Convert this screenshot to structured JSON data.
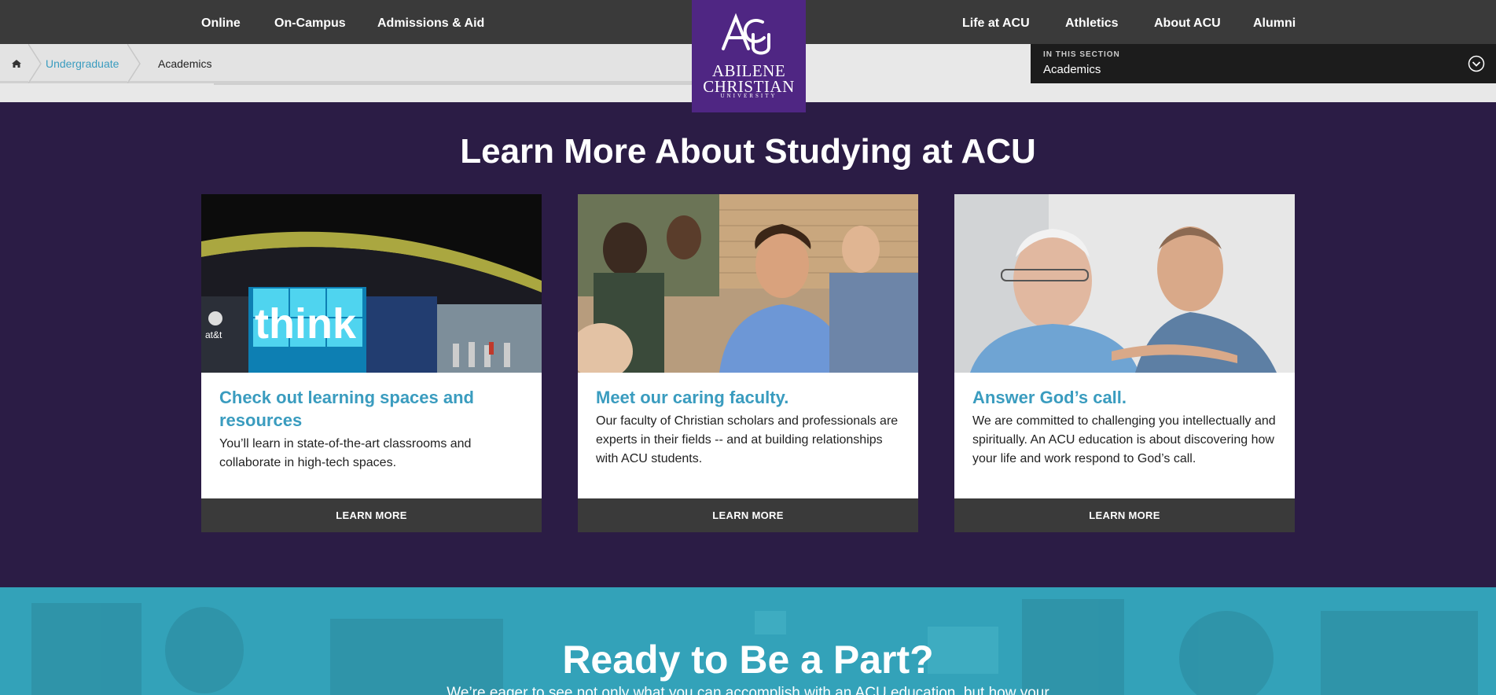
{
  "nav": {
    "left": [
      "Online",
      "On-Campus",
      "Admissions & Aid"
    ],
    "right": [
      "Life at ACU",
      "Athletics",
      "About ACU",
      "Alumni"
    ]
  },
  "logo": {
    "line1": "ABILENE",
    "line2": "CHRISTIAN",
    "line3": "UNIVERSITY",
    "brand_color": "#4f2683"
  },
  "breadcrumb": {
    "home_icon": "home-icon",
    "items": [
      "Undergraduate",
      "Academics"
    ]
  },
  "section_selector": {
    "label": "IN THIS SECTION",
    "value": "Academics",
    "icon": "chevron-circle-down-icon"
  },
  "main": {
    "title": "Learn More About Studying at ACU",
    "cards": [
      {
        "title": "Check out learning spaces and resources",
        "text": "You’ll learn in state-of-the-art classrooms and collaborate in high-tech spaces.",
        "button": "LEARN MORE",
        "image_screen_text": "think",
        "image_sign_text": "at&t"
      },
      {
        "title": "Meet our caring faculty.",
        "text": "Our faculty of Christian scholars and professionals are experts in their fields -- and at building relationships with ACU students.",
        "button": "LEARN MORE"
      },
      {
        "title": "Answer God’s call.",
        "text": "We are committed to challenging you intellectually and spiritually. An ACU education is about discovering how your life and work respond to God’s call.",
        "button": "LEARN MORE"
      }
    ]
  },
  "cta": {
    "title": "Ready to Be a Part?",
    "subtitle": "We’re eager to see not only what you can accomplish with an ACU education, but how your"
  },
  "colors": {
    "purple_bg": "#2b1c45",
    "accent_teal": "#3a9cbf",
    "nav_bg": "#3a3a3a"
  }
}
